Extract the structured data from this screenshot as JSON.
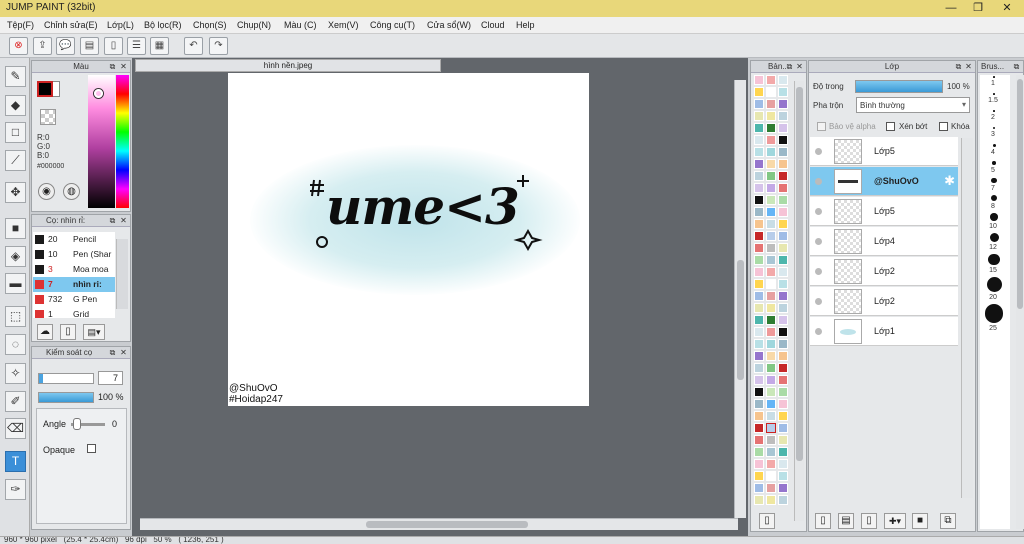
{
  "app": {
    "title": "JUMP PAINT (32bit)"
  },
  "window_controls": {
    "minimize": "—",
    "maximize": "❐",
    "close": "✕"
  },
  "menu": [
    "Tệp(F)",
    "Chỉnh sửa(E)",
    "Lớp(L)",
    "Bộ lọc(R)",
    "Chọn(S)",
    "Chụp(N)",
    "Màu (C)",
    "Xem(V)",
    "Công cụ(T)",
    "Cửa sổ(W)",
    "Cloud",
    "Help"
  ],
  "color_panel": {
    "title": "Màu",
    "r": "R:0",
    "g": "G:0",
    "b": "B:0",
    "hex": "#000000",
    "fg_color": "#000000",
    "bg_color": "#ffffff"
  },
  "brush_panel": {
    "title": "Cọ: nhìn rỉ:",
    "items": [
      {
        "size": "20",
        "name": "Pencil",
        "color": "#1a1a1a"
      },
      {
        "size": "10",
        "name": "Pen (Shar",
        "color": "#1a1a1a"
      },
      {
        "size": "3",
        "name": "Moa moa",
        "color": "#d33"
      },
      {
        "size": "7",
        "name": "nhìn rỉ:",
        "color": "#d33",
        "selected": true
      },
      {
        "size": "732",
        "name": "G Pen",
        "color": "#d33"
      },
      {
        "size": "1",
        "name": "Grid",
        "color": "#d33"
      }
    ]
  },
  "control_panel": {
    "title": "Kiểm soát cọ",
    "size_value": "7",
    "opacity_value": "100 %",
    "angle_label": "Angle",
    "angle_value": "0",
    "opaque_label": "Opaque"
  },
  "canvas": {
    "tab_title": "hình nền.jpeg",
    "credit_line1": "@ShuOvO",
    "credit_line2": "#Hoidap247",
    "art_text": "ume<3"
  },
  "palette_panel": {
    "title": "Bản..."
  },
  "layer_panel": {
    "title": "Lớp",
    "opacity_label": "Độ trong",
    "opacity_value": "100 %",
    "blend_label": "Pha trộn",
    "blend_value": "Bình thường",
    "protect_alpha": "Bảo vệ alpha",
    "clip": "Xén bớt",
    "lock": "Khóa",
    "layers": [
      {
        "name": "Lớp5",
        "selected": false
      },
      {
        "name": "@ShuOvO",
        "selected": true
      },
      {
        "name": "Lớp5",
        "selected": false
      },
      {
        "name": "Lớp4",
        "selected": false
      },
      {
        "name": "Lớp2",
        "selected": false
      },
      {
        "name": "Lớp2",
        "selected": false
      },
      {
        "name": "Lớp1",
        "selected": false
      }
    ]
  },
  "brushsize_panel": {
    "title": "Brus...",
    "sizes": [
      "1",
      "1.5",
      "2",
      "3",
      "4",
      "5",
      "7",
      "8",
      "10",
      "12",
      "15",
      "20",
      "25"
    ]
  },
  "status": {
    "text": "960 * 960 pixel   (25.4 * 25.4cm)   96 dpi   50 %   ( 1236, 251 )"
  }
}
